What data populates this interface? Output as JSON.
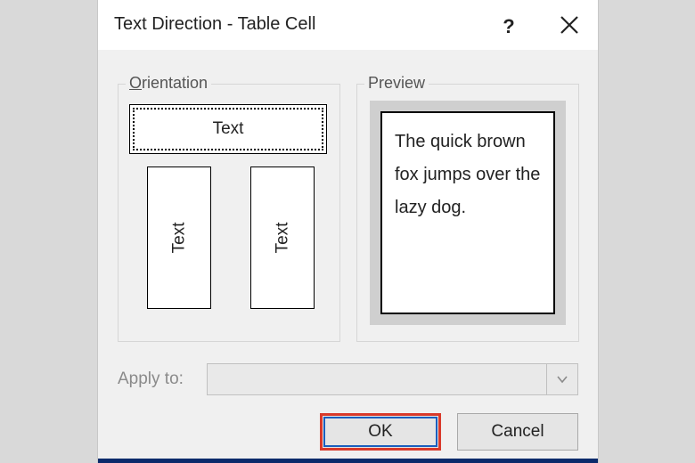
{
  "title": "Text Direction - Table Cell",
  "orientation": {
    "label_prefix": "O",
    "label_rest": "rientation",
    "option_text": "Text"
  },
  "preview": {
    "label_prefix": "P",
    "label_rest": "review",
    "sample": "The quick brown fox jumps over the lazy dog."
  },
  "apply": {
    "label": "Apply to:",
    "value": ""
  },
  "buttons": {
    "ok": "OK",
    "cancel": "Cancel"
  }
}
